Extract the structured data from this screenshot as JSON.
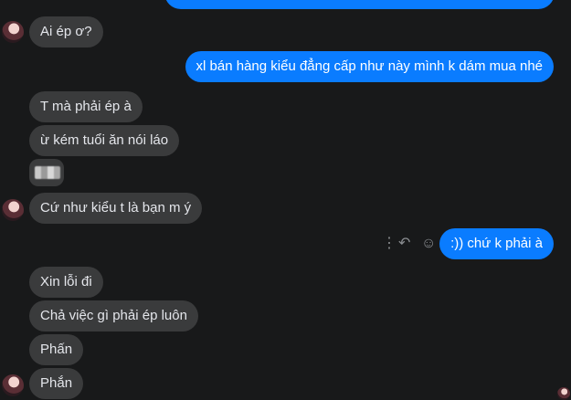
{
  "conversation": {
    "messages": [
      {
        "side": "out",
        "text": ""
      },
      {
        "side": "in",
        "text": "Ai ép ơ?"
      },
      {
        "side": "out",
        "text": "xl bán hàng kiểu đẳng cấp như này mình k dám mua nhé"
      },
      {
        "side": "in",
        "text": "T mà phải ép à"
      },
      {
        "side": "in",
        "text": "ừ kém tuổi ăn nói láo"
      },
      {
        "side": "in",
        "text": ""
      },
      {
        "side": "in",
        "text": "Cứ như kiểu t là bạn m ý"
      },
      {
        "side": "out",
        "text": ":)) chứ k phải à"
      },
      {
        "side": "in",
        "text": "Xin lỗi đi"
      },
      {
        "side": "in",
        "text": "Chả việc gì phải ép luôn"
      },
      {
        "side": "in",
        "text": "Phấn"
      },
      {
        "side": "in",
        "text": "Phắn"
      }
    ]
  },
  "icons": {
    "more": "more-vertical-icon",
    "reply": "reply-icon",
    "react": "smiley-icon"
  },
  "colors": {
    "background": "#18191a",
    "incoming_bubble": "#3a3b3c",
    "outgoing_bubble": "#0a7cff"
  }
}
